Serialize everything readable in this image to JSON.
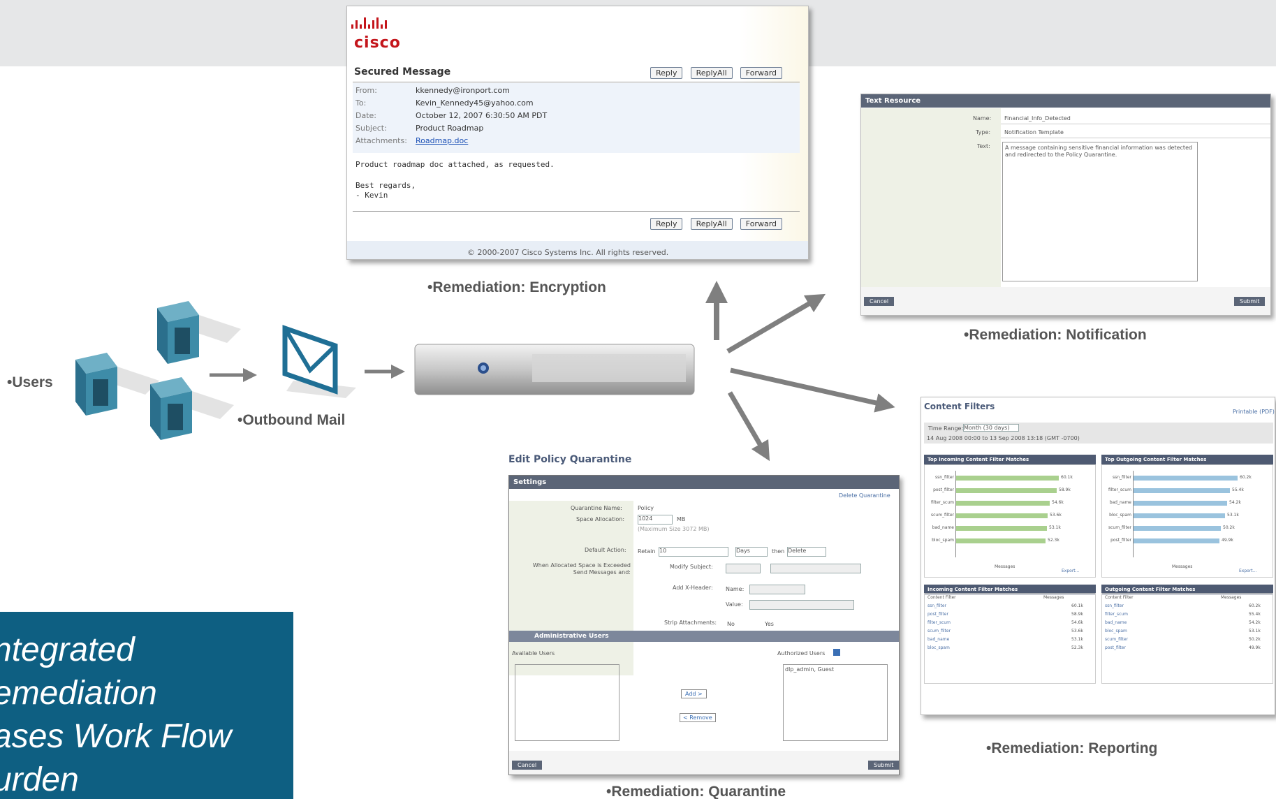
{
  "labels": {
    "users": "•Users",
    "outbound_mail": "•Outbound Mail",
    "encryption": "•Remediation:  Encryption",
    "notification": "•Remediation: Notification",
    "reporting": "•Remediation: Reporting",
    "quarantine": "•Remediation: Quarantine"
  },
  "callout": {
    "line1": "ntegrated",
    "line2": "emediation",
    "line3": "ases Work Flow",
    "line4": "urden"
  },
  "encryption_shot": {
    "logo": "cisco",
    "title": "Secured Message",
    "buttons": [
      "Reply",
      "ReplyAll",
      "Forward"
    ],
    "fields": [
      {
        "label": "From:",
        "value": "kkennedy@ironport.com"
      },
      {
        "label": "To:",
        "value": "Kevin_Kennedy45@yahoo.com"
      },
      {
        "label": "Date:",
        "value": "October 12, 2007 6:30:50 AM PDT"
      },
      {
        "label": "Subject:",
        "value": "Product Roadmap"
      },
      {
        "label": "Attachments:",
        "value": "Roadmap.doc"
      }
    ],
    "body": "Product roadmap doc attached, as requested.",
    "signoff1": "Best regards,",
    "signoff2": "- Kevin",
    "footer": "© 2000-2007 Cisco Systems Inc. All rights reserved."
  },
  "notification_shot": {
    "header": "Text Resource",
    "name_label": "Name:",
    "name_value": "Financial_Info_Detected",
    "type_label": "Type:",
    "type_value": "Notification Template",
    "text_label": "Text:",
    "text_value": "A message containing sensitive financial information was detected and redirected to the Policy Quarantine.",
    "cancel": "Cancel",
    "submit": "Submit"
  },
  "quarantine_shot": {
    "title": "Edit Policy Quarantine",
    "settings": "Settings",
    "delete_link": "Delete Quarantine",
    "qname_label": "Quarantine Name:",
    "qname_value": "Policy",
    "space_label": "Space Allocation:",
    "space_value": "1024",
    "space_unit": "MB",
    "space_hint": "(Maximum Size 3072 MB)",
    "default_label": "Default Action:",
    "retain": "Retain",
    "retain_value": "10",
    "days": "Days",
    "then": "then",
    "delete": "Delete",
    "exceeded_label": "When Allocated Space is Exceeded Send Messages and:",
    "modify_subject": "Modify Subject:",
    "add_header": "Add X-Header:",
    "name": "Name:",
    "value": "Value:",
    "strip": "Strip Attachments:",
    "no": "No",
    "yes": "Yes",
    "admin_users": "Administrative Users",
    "available_users": "Available Users",
    "authorized_users": "Authorized Users",
    "authorized_list": "dlp_admin, Guest",
    "add_btn": "Add >",
    "remove_btn": "< Remove",
    "cancel": "Cancel",
    "submit": "Submit"
  },
  "reporting_shot": {
    "title": "Content Filters",
    "printable": "Printable (PDF)",
    "time_range_label": "Time Range:",
    "time_range_value": "Month (30 days)",
    "date_range": "14 Aug 2008 00:00 to 13 Sep 2008 13:18 (GMT -0700)",
    "incoming_header": "Top Incoming Content Filter Matches",
    "outgoing_header": "Top Outgoing Content Filter Matches",
    "messages_axis": "Messages",
    "export": "Export...",
    "incoming_table": "Incoming Content Filter Matches",
    "outgoing_table": "Outgoing Content Filter Matches",
    "col_filter": "Content Filter",
    "col_messages": "Messages",
    "incoming_rows": [
      {
        "name": "ssn_filter",
        "value": "60.1k"
      },
      {
        "name": "post_filter",
        "value": "58.9k"
      },
      {
        "name": "filter_scum",
        "value": "54.6k"
      },
      {
        "name": "scum_filter",
        "value": "53.6k"
      },
      {
        "name": "bad_name",
        "value": "53.1k"
      },
      {
        "name": "bloc_spam",
        "value": "52.3k"
      }
    ],
    "outgoing_rows": [
      {
        "name": "ssn_filter",
        "value": "60.2k"
      },
      {
        "name": "filter_scum",
        "value": "55.4k"
      },
      {
        "name": "bad_name",
        "value": "54.2k"
      },
      {
        "name": "bloc_spam",
        "value": "53.1k"
      },
      {
        "name": "scum_filter",
        "value": "50.2k"
      },
      {
        "name": "post_filter",
        "value": "49.9k"
      }
    ],
    "incoming_bars": [
      0.92,
      0.9,
      0.84,
      0.82,
      0.81,
      0.8
    ],
    "outgoing_bars": [
      0.93,
      0.86,
      0.84,
      0.82,
      0.78,
      0.77
    ],
    "incoming_color": "#a9d08e",
    "outgoing_color": "#9ac3de"
  },
  "colors": {
    "top_band": "#e6e7e8",
    "callout": "#0e5f82",
    "caption": "#555555",
    "arrow": "#7f7f7f",
    "box_front": "#3e8ca8",
    "envelope": "#1f6f95"
  }
}
